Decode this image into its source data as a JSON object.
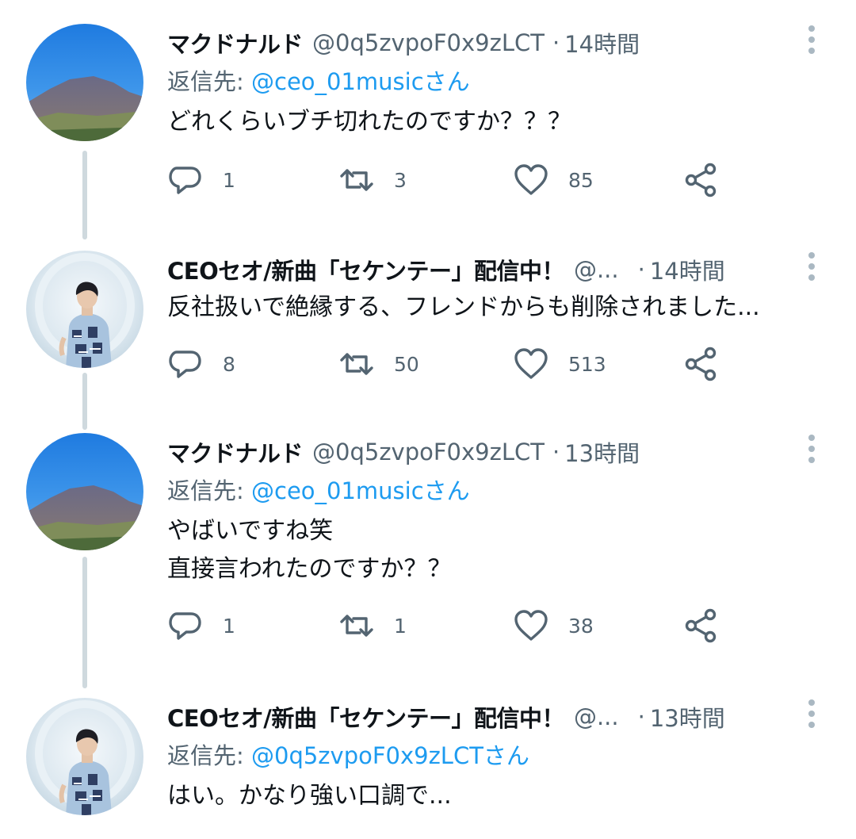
{
  "tweets": [
    {
      "name": "マクドナルド",
      "handle": "@0q5zvpoF0x9zLCT",
      "separator": "·",
      "time": "14時間",
      "reply_label": "返信先: ",
      "reply_mention": "@ceo_01musicさん",
      "lines": [
        "どれくらいブチ切れたのですか？？？"
      ],
      "replies": "1",
      "retweets": "3",
      "likes": "85",
      "avatar": "mountain-avatar"
    },
    {
      "name": "CEOセオ/新曲「セケンテー」配信中！",
      "handle": "@...",
      "separator": "·",
      "time": "14時間",
      "lines": [
        "反社扱いで絶縁する、フレンドからも削除されました..."
      ],
      "replies": "8",
      "retweets": "50",
      "likes": "513",
      "avatar": "person-avatar"
    },
    {
      "name": "マクドナルド",
      "handle": "@0q5zvpoF0x9zLCT",
      "separator": "·",
      "time": "13時間",
      "reply_label": "返信先: ",
      "reply_mention": "@ceo_01musicさん",
      "lines": [
        "やばいですね笑",
        "直接言われたのですか？？"
      ],
      "replies": "1",
      "retweets": "1",
      "likes": "38",
      "avatar": "mountain-avatar"
    },
    {
      "name": "CEOセオ/新曲「セケンテー」配信中！",
      "handle": "@...",
      "separator": "·",
      "time": "13時間",
      "reply_label": "返信先: ",
      "reply_mention": "@0q5zvpoF0x9zLCTさん",
      "lines": [
        "はい。かなり強い口調で..."
      ],
      "avatar": "person-avatar"
    }
  ],
  "colors": {
    "text": "#0f1419",
    "secondary": "#536471",
    "link": "#1d9bf0",
    "thread_line": "#cfd9de"
  },
  "icons": [
    "reply-icon",
    "retweet-icon",
    "like-icon",
    "share-icon",
    "more-icon"
  ]
}
